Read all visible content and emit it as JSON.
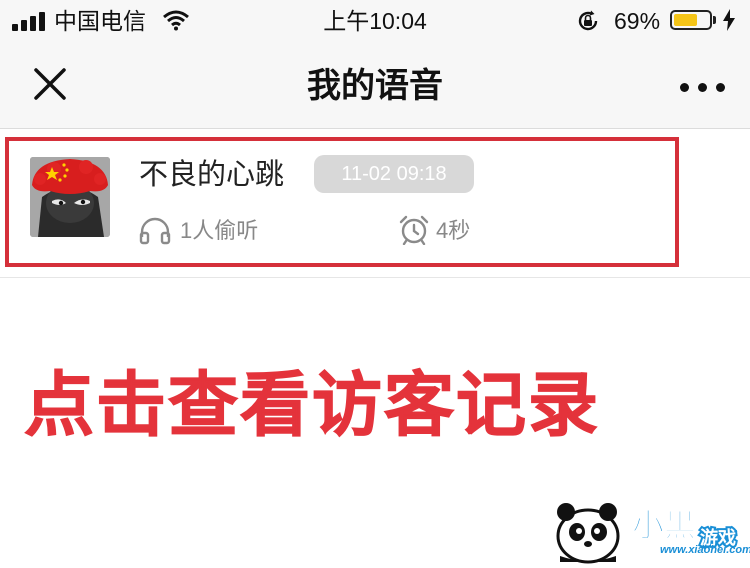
{
  "status_bar": {
    "carrier": "中国电信",
    "time": "上午10:04",
    "battery_percent": "69%",
    "battery_level": 0.69
  },
  "nav": {
    "title": "我的语音",
    "close_icon": "close-icon",
    "more_icon": "more-icon"
  },
  "voice_item": {
    "title": "不良的心跳",
    "timestamp": "11-02 09:18",
    "listeners": "1人偷听",
    "duration": "4秒"
  },
  "caption": "点击查看访客记录",
  "watermark": {
    "brand": "小黑游戏",
    "url": "www.xiaohei.com"
  },
  "colors": {
    "highlight": "#d5303a",
    "caption": "#e4333b",
    "battery": "#f5c518"
  }
}
